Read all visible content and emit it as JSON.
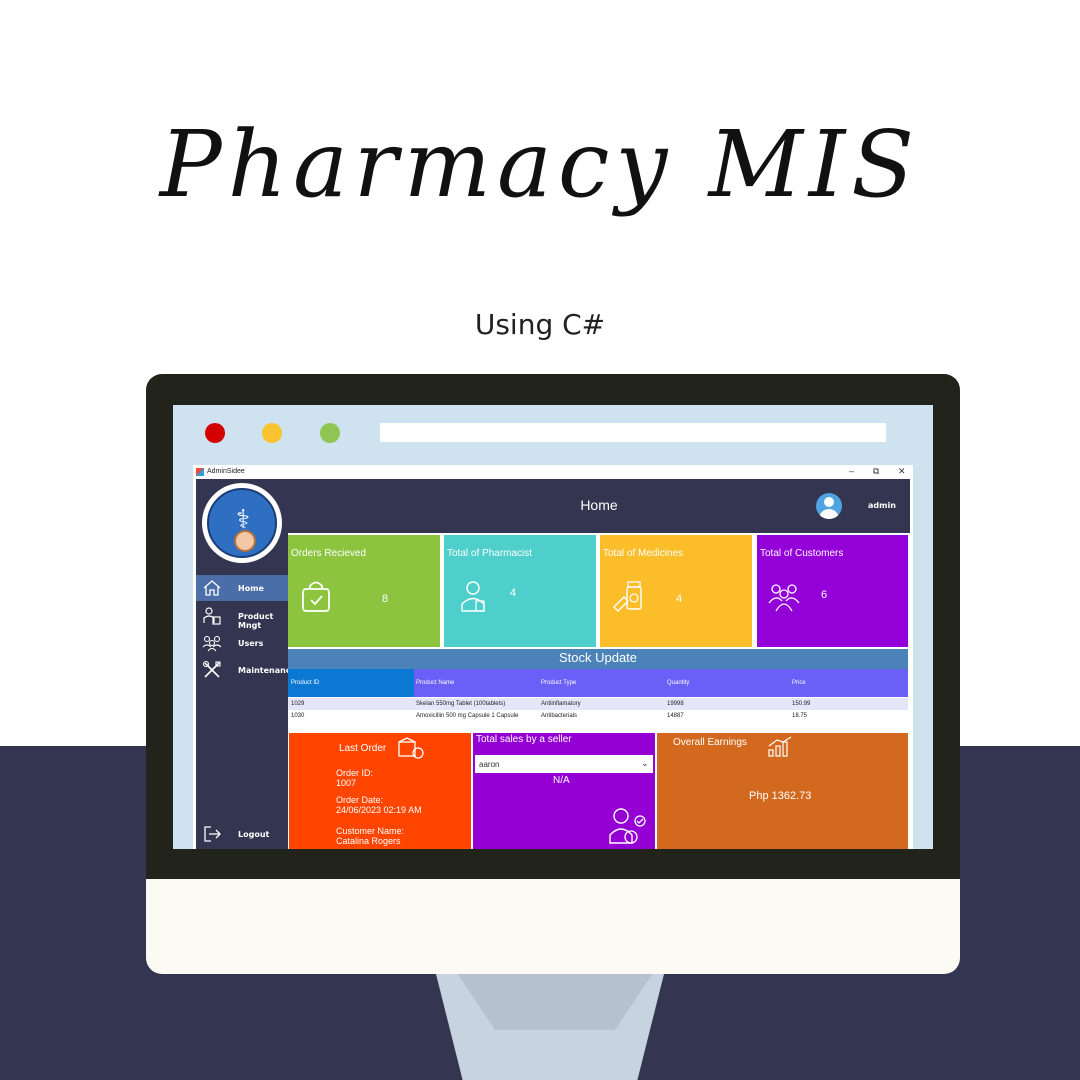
{
  "poster": {
    "headline": "Pharmacy MIS",
    "subtitle": "Using C#",
    "colors": {
      "background": "#ffffff",
      "band": "#343550",
      "monitor_frame": "#22231b"
    }
  },
  "browser_mock": {
    "dots": [
      {
        "name": "close-dot",
        "color": "#d40000"
      },
      {
        "name": "minimize-dot",
        "color": "#f9c22f"
      },
      {
        "name": "maximize-dot",
        "color": "#8fc552"
      }
    ],
    "url_value": ""
  },
  "window": {
    "title": "AdminSidee",
    "controls": {
      "minimize": "–",
      "restore": "⧉",
      "close": "✕"
    }
  },
  "sidebar": {
    "items": [
      {
        "label": "Home",
        "icon": "home-icon",
        "active": true
      },
      {
        "label": "Product Mngt",
        "icon": "product-management-icon",
        "active": false
      },
      {
        "label": "Users",
        "icon": "users-icon",
        "active": false
      },
      {
        "label": "Maintenance",
        "icon": "maintenance-icon",
        "active": false
      }
    ],
    "logout": {
      "label": "Logout",
      "icon": "logout-icon"
    }
  },
  "header": {
    "title": "Home",
    "username": "admin"
  },
  "cards": [
    {
      "title": "Orders Recieved",
      "value": "8",
      "color": "#8cc43f",
      "icon": "shopping-bag-icon"
    },
    {
      "title": "Total of Pharmacist",
      "value": "4",
      "color": "#4ecfcb",
      "icon": "pharmacist-icon"
    },
    {
      "title": "Total of Medicines",
      "value": "4",
      "color": "#fbbd2a",
      "icon": "medicines-icon"
    },
    {
      "title": "Total of Customers",
      "value": "6",
      "color": "#9300d8",
      "icon": "customers-icon"
    }
  ],
  "stock": {
    "title": "Stock Update",
    "columns": [
      "Product ID",
      "Product Name",
      "Product Type",
      "Quantity",
      "Price"
    ],
    "rows": [
      [
        "1029",
        "Skelan 550mg Tablet (100tablets)",
        "Antiinflamatory",
        "19998",
        "150.99"
      ],
      [
        "1030",
        "Amoxicillin 500 mg Capsule 1 Capsule",
        "Antibacterials",
        "14887",
        "18.75"
      ]
    ]
  },
  "last_order": {
    "title": "Last Order",
    "order_id_label": "Order ID:",
    "order_id": "1007",
    "order_date_label": "Order Date:",
    "order_date": "24/06/2023 02:19 AM",
    "customer_label": "Customer Name:",
    "customer_name": "Catalina Rogers",
    "color": "#ff4500"
  },
  "seller_sales": {
    "title": "Total sales by a seller",
    "selected_seller": "aaron",
    "result": "N/A",
    "color": "#9400d3"
  },
  "earnings": {
    "title": "Overall Earnings",
    "value": "Php 1362.73",
    "color": "#d2691e"
  }
}
